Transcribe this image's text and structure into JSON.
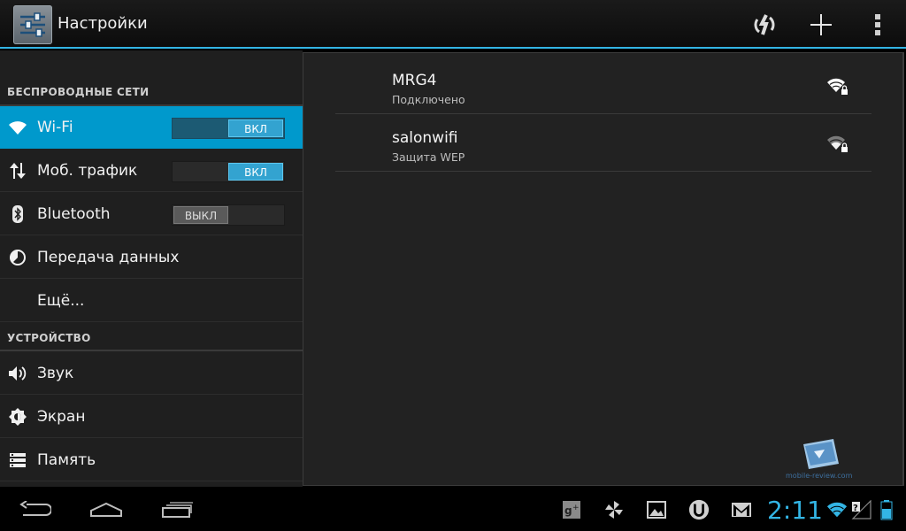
{
  "action_bar": {
    "title": "Настройки",
    "app_icon": "settings-sliders-icon",
    "actions": [
      "sync-icon",
      "add-icon",
      "overflow-menu-icon"
    ]
  },
  "sidebar": {
    "sections": [
      {
        "header": "БЕСПРОВОДНЫЕ СЕТИ"
      },
      {
        "header": "УСТРОЙСТВО"
      }
    ],
    "items": [
      {
        "label": "Wi-Fi",
        "icon": "wifi-icon",
        "switch": "ВКЛ",
        "state": "on",
        "selected": true
      },
      {
        "label": "Моб. трафик",
        "icon": "data-transfer-icon",
        "switch": "ВКЛ",
        "state": "on"
      },
      {
        "label": "Bluetooth",
        "icon": "bluetooth-icon",
        "switch": "ВЫКЛ",
        "state": "off"
      },
      {
        "label": "Передача данных",
        "icon": "data-usage-icon"
      },
      {
        "label": "Ещё..."
      },
      {
        "label": "Звук",
        "icon": "speaker-icon"
      },
      {
        "label": "Экран",
        "icon": "brightness-icon"
      },
      {
        "label": "Память",
        "icon": "storage-icon"
      }
    ]
  },
  "networks": [
    {
      "ssid": "MRG4",
      "status": "Подключено",
      "signal": "full",
      "secured": true
    },
    {
      "ssid": "salonwifi",
      "status": "Защита WEP",
      "signal": "medium",
      "secured": true
    }
  ],
  "watermark": {
    "text": "mobile-review.com"
  },
  "system_bar": {
    "nav": [
      "back-icon",
      "home-icon",
      "recent-apps-icon"
    ],
    "notifications": [
      "google-plus-icon",
      "pinwheel-icon",
      "gallery-icon",
      "utorrent-icon",
      "gmail-icon"
    ],
    "clock": "2:11",
    "status_icons": [
      "wifi-status-icon",
      "mobile-signal-icon",
      "battery-icon"
    ],
    "colors": {
      "accent": "#33b5e5",
      "selected_row": "#0099cc"
    }
  }
}
